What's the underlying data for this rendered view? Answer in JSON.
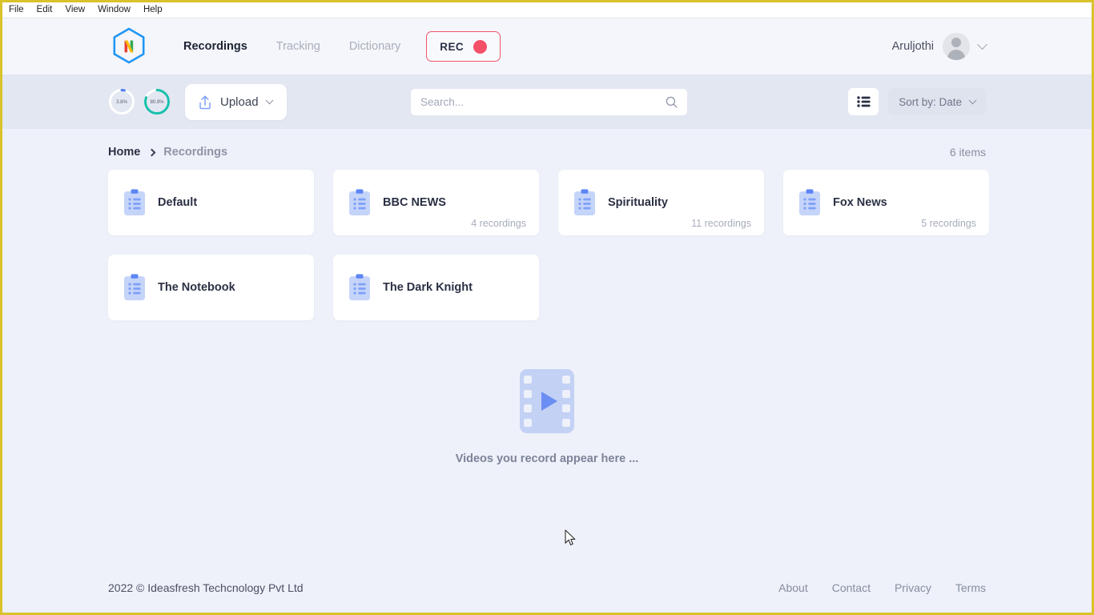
{
  "window": {
    "menu": [
      "File",
      "Edit",
      "View",
      "Window",
      "Help"
    ]
  },
  "navbar": {
    "logo_letter": "N",
    "links": [
      {
        "label": "Recordings",
        "active": true
      },
      {
        "label": "Tracking",
        "active": false
      },
      {
        "label": "Dictionary",
        "active": false
      }
    ],
    "rec_button": {
      "label": "REC",
      "dot_color": "#f45068"
    },
    "user": {
      "name": "Aruljothi"
    }
  },
  "toolbar": {
    "rings": [
      {
        "label": "3.8%",
        "value": 3.8,
        "color": "#4d7cf3",
        "track": "#ffffff"
      },
      {
        "label": "80.9%",
        "value": 80.9,
        "color": "#19c0ad",
        "track": "#ffffff"
      }
    ],
    "upload_label": "Upload",
    "search": {
      "placeholder": "Search...",
      "value": ""
    },
    "sort_label": "Sort by: Date",
    "view_mode": "list"
  },
  "content": {
    "breadcrumb": [
      {
        "label": "Home",
        "muted": false
      },
      {
        "label": "Recordings",
        "muted": true
      }
    ],
    "items_count": "6 items",
    "folders": [
      {
        "name": "Default",
        "recordings": ""
      },
      {
        "name": "BBC NEWS",
        "recordings": "4 recordings"
      },
      {
        "name": "Spirituality",
        "recordings": "11 recordings"
      },
      {
        "name": "Fox News",
        "recordings": "5 recordings"
      },
      {
        "name": "The Notebook",
        "recordings": ""
      },
      {
        "name": "The Dark Knight",
        "recordings": ""
      }
    ],
    "empty_state": {
      "text": "Videos you record appear here ..."
    }
  },
  "footer": {
    "copyright": "2022 © Ideasfresh Techcnology Pvt Ltd",
    "links": [
      "About",
      "Contact",
      "Privacy",
      "Terms"
    ]
  },
  "colors": {
    "accent_blue": "#4d7cf3",
    "accent_teal": "#19c0ad",
    "rec_red": "#f45068",
    "icon_blue_light": "#c5d4f9",
    "icon_blue_dark": "#5c85f6",
    "page_bg": "#eef1f9",
    "toolbar_bg": "#e3e7f1",
    "navbar_bg": "#f4f6fb"
  }
}
